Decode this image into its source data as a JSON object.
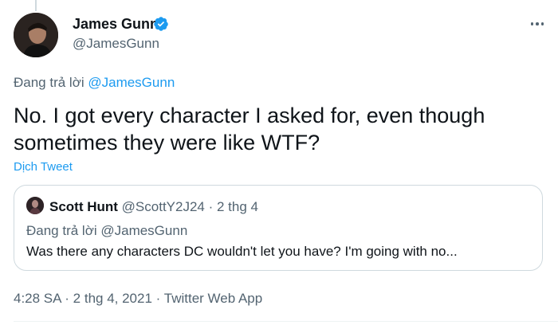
{
  "tweet": {
    "author": {
      "name": "James Gunn",
      "handle": "@JamesGunn",
      "verified": true
    },
    "reply_prefix": "Đang trả lời ",
    "reply_to": "@JamesGunn",
    "text": "No. I got every character I asked for, even though sometimes they were like WTF?",
    "translate_label": "Dịch Tweet",
    "time": "4:28 SA",
    "separator": " · ",
    "date": "2 thg 4, 2021",
    "source": "Twitter Web App"
  },
  "quoted": {
    "name": "Scott Hunt",
    "handle": "@ScottY2J24",
    "meta_sep": " · ",
    "date": "2 thg 4",
    "reply_prefix": "Đang trả lời ",
    "reply_to": "@JamesGunn",
    "text": "Was there any characters DC wouldn't let you have? I'm going with no..."
  },
  "colors": {
    "accent": "#1d9bf0",
    "secondary_text": "#536471",
    "border": "#cfd9de"
  },
  "icons": {
    "verified": "verified-badge-icon",
    "more": "more-options-icon"
  }
}
